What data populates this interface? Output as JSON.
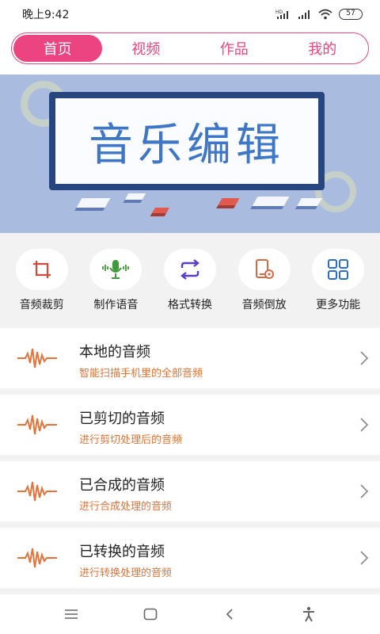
{
  "status": {
    "time": "晚上9:42",
    "battery": "57"
  },
  "tabs": [
    {
      "label": "首页",
      "active": true
    },
    {
      "label": "视频",
      "active": false
    },
    {
      "label": "作品",
      "active": false
    },
    {
      "label": "我的",
      "active": false
    }
  ],
  "banner": {
    "title": "音乐编辑"
  },
  "features": [
    {
      "label": "音频裁剪",
      "icon": "crop-icon"
    },
    {
      "label": "制作语音",
      "icon": "microphone-icon"
    },
    {
      "label": "格式转换",
      "icon": "convert-icon"
    },
    {
      "label": "音频倒放",
      "icon": "reverse-play-icon"
    },
    {
      "label": "更多功能",
      "icon": "grid-icon"
    }
  ],
  "list": [
    {
      "title": "本地的音频",
      "subtitle": "智能扫描手机里的全部音频"
    },
    {
      "title": "已剪切的音频",
      "subtitle": "进行剪切处理后的音频"
    },
    {
      "title": "已合成的音频",
      "subtitle": "进行合成处理的音频"
    },
    {
      "title": "已转换的音频",
      "subtitle": "进行转换处理的音频"
    }
  ],
  "colors": {
    "accent": "#ec4480",
    "wave": "#e2743a",
    "subtitle": "#e2743a",
    "banner": "#a9bcdf"
  }
}
